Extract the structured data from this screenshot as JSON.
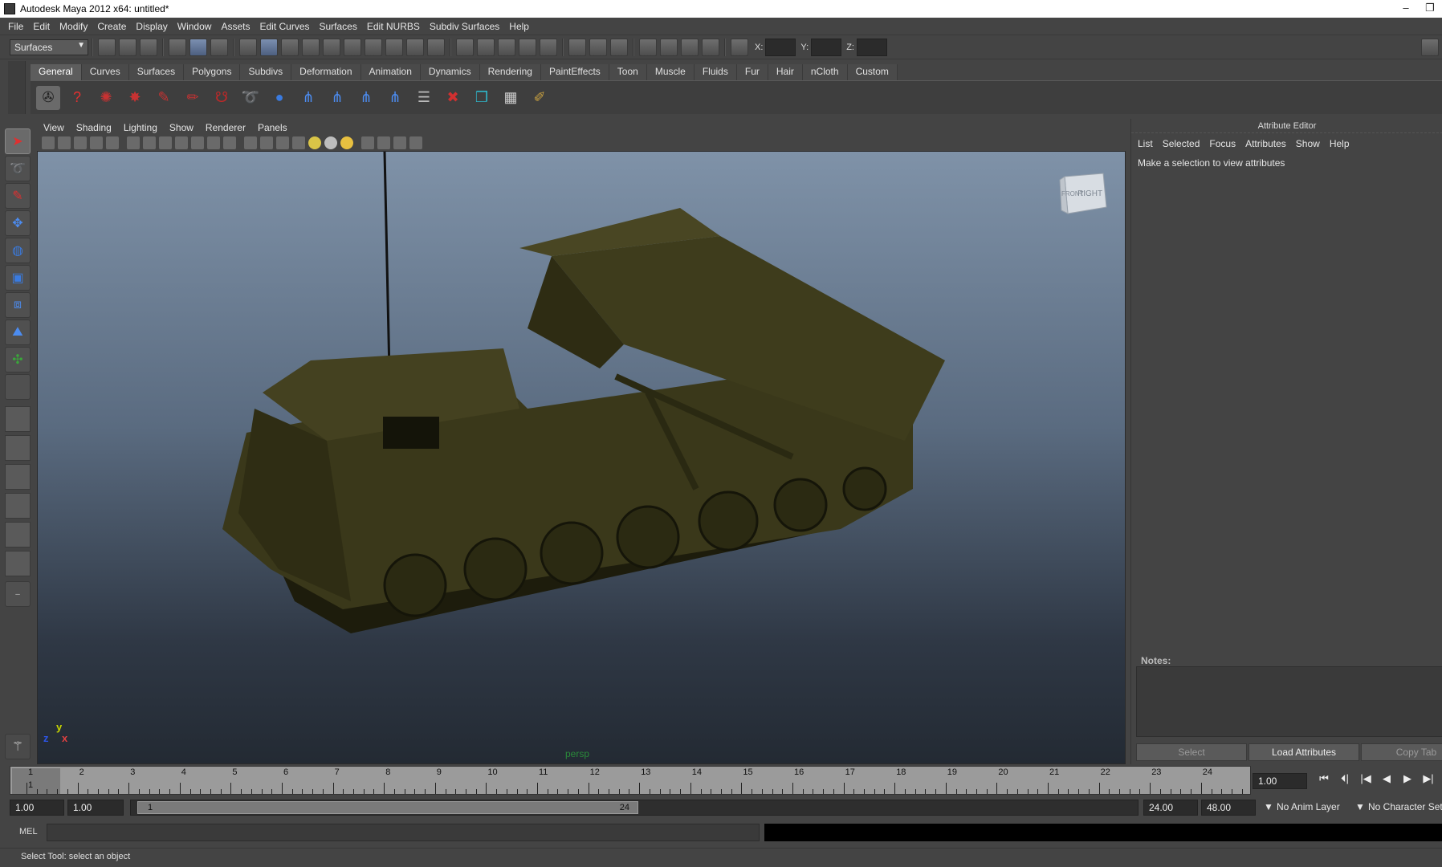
{
  "window": {
    "title": "Autodesk Maya 2012 x64: untitled*",
    "controls": [
      "–",
      "❐"
    ]
  },
  "main_menu": [
    "File",
    "Edit",
    "Modify",
    "Create",
    "Display",
    "Window",
    "Assets",
    "Edit Curves",
    "Surfaces",
    "Edit NURBS",
    "Subdiv Surfaces",
    "Help"
  ],
  "status_line": {
    "menu_set": "Surfaces",
    "coord_labels": {
      "x": "X:",
      "y": "Y:",
      "z": "Z:"
    }
  },
  "shelf": {
    "tabs": [
      "General",
      "Curves",
      "Surfaces",
      "Polygons",
      "Subdivs",
      "Deformation",
      "Animation",
      "Dynamics",
      "Rendering",
      "PaintEffects",
      "Toon",
      "Muscle",
      "Fluids",
      "Fur",
      "Hair",
      "nCloth",
      "Custom"
    ],
    "active_tab": "General"
  },
  "viewport": {
    "menu": [
      "View",
      "Shading",
      "Lighting",
      "Show",
      "Renderer",
      "Panels"
    ],
    "camera_label": "persp",
    "viewcube": {
      "front": "FRONT",
      "right": "RIGHT"
    },
    "axes": {
      "y": "y",
      "x": "x",
      "z": "z"
    },
    "colors": {
      "bg_top": "#7f92a8",
      "bg_bottom": "#232a33",
      "model": "#3c3a1c"
    }
  },
  "attribute_editor": {
    "title": "Attribute Editor",
    "menu": [
      "List",
      "Selected",
      "Focus",
      "Attributes",
      "Show",
      "Help"
    ],
    "message": "Make a selection to view attributes",
    "notes_label": "Notes:",
    "buttons": {
      "select": "Select",
      "load": "Load Attributes",
      "copy": "Copy Tab"
    }
  },
  "time_slider": {
    "frames": [
      "1",
      "2",
      "3",
      "4",
      "5",
      "6",
      "7",
      "8",
      "9",
      "10",
      "11",
      "12",
      "13",
      "14",
      "15",
      "16",
      "17",
      "18",
      "19",
      "20",
      "21",
      "22",
      "23",
      "24"
    ],
    "current_frame_marker": "1",
    "current_time": "1.00"
  },
  "range_slider": {
    "start_time": "1.00",
    "playback_start": "1.00",
    "range_start_label": "1",
    "range_end_label": "24",
    "playback_end": "24.00",
    "end_time": "48.00",
    "anim_layer": "No Anim Layer",
    "character_set": "No Character Set"
  },
  "command_line": {
    "label": "MEL"
  },
  "help_line": {
    "text": "Select Tool: select an object"
  }
}
